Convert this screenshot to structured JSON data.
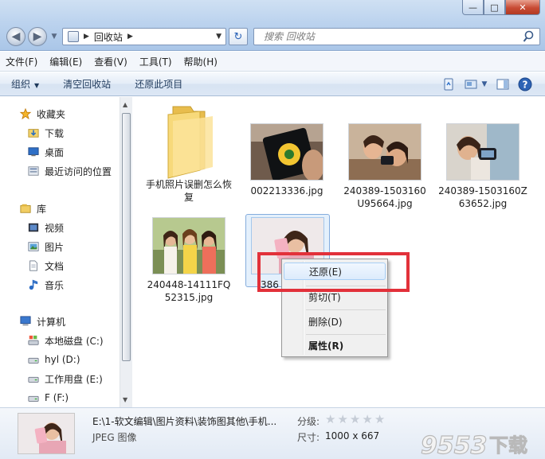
{
  "window": {
    "minimize_glyph": "—",
    "maximize_glyph": "□",
    "close_glyph": "✕"
  },
  "address": {
    "segment": "回收站",
    "refresh_glyph": "↻"
  },
  "search": {
    "placeholder": "搜索 回收站"
  },
  "menubar": {
    "items": [
      "文件(F)",
      "编辑(E)",
      "查看(V)",
      "工具(T)",
      "帮助(H)"
    ]
  },
  "toolbar": {
    "organize": "组织",
    "empty_bin": "清空回收站",
    "restore_all": "还原此项目"
  },
  "nav": {
    "favorites": "收藏夹",
    "downloads": "下载",
    "desktop": "桌面",
    "recent": "最近访问的位置",
    "libraries": "库",
    "videos": "视频",
    "pictures": "图片",
    "documents": "文档",
    "music": "音乐",
    "computer": "计算机",
    "drive_c": "本地磁盘 (C:)",
    "drive_d": "hyl (D:)",
    "drive_e": "工作用盘 (E:)",
    "drive_f": "F (F:)"
  },
  "files": [
    {
      "name": "手机照片误删怎么恢复",
      "kind": "folder"
    },
    {
      "name": "002213336.jpg",
      "kind": "image"
    },
    {
      "name": "240389-1503160U95664.jpg",
      "kind": "image"
    },
    {
      "name": "240389-1503160Z63652.jpg",
      "kind": "image"
    },
    {
      "name": "240448-14111FQ52315.jpg",
      "kind": "image"
    },
    {
      "name": "386",
      "kind": "image",
      "selected": true
    }
  ],
  "context_menu": {
    "items": [
      "还原(E)",
      "剪切(T)",
      "删除(D)",
      "属性(R)"
    ],
    "highlighted": "还原(E)"
  },
  "details": {
    "path": "E:\\1-软文编辑\\图片资料\\装饰图其他\\手机...",
    "type": "JPEG 图像",
    "rating_label": "分级:",
    "rating": 0,
    "rating_max": 5,
    "size_label": "尺寸:",
    "size_value": "1000 x 667"
  },
  "watermark": "9553下载",
  "colors": {
    "highlight_box": "#e2313a",
    "accent": "#1e395b"
  }
}
